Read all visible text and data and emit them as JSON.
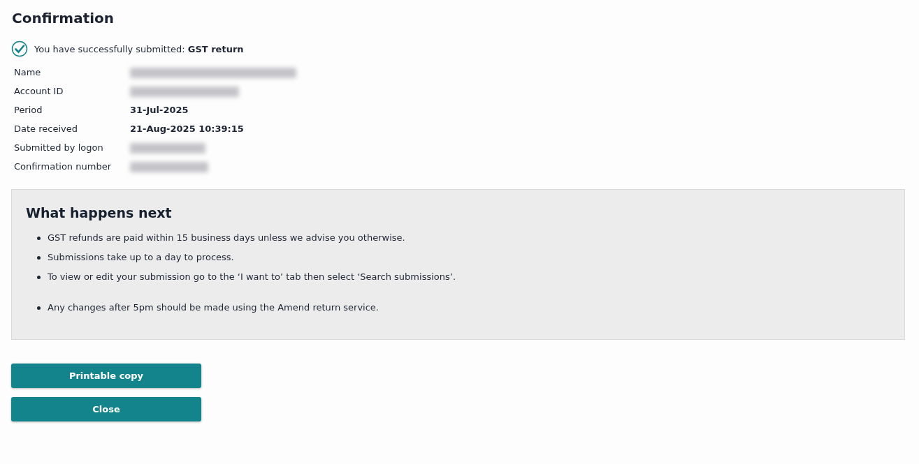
{
  "title": "Confirmation",
  "success": {
    "checked": true,
    "text": "You have successfully submitted: **GST return**"
  },
  "details": [
    {
      "label": "Name",
      "redacted": true
    },
    {
      "label": "Account ID",
      "redacted": true
    },
    {
      "label": "Period",
      "redacted": false,
      "value": "31-Jul-2025"
    },
    {
      "label": "Date received",
      "redacted": false,
      "value": "21-Aug-2025 10:39:15"
    },
    {
      "label": "Submitted by logon",
      "redacted": true
    },
    {
      "label": "Confirmation number",
      "redacted": true
    }
  ],
  "next": {
    "heading": "What happens next",
    "groups": [
      [
        "GST refunds are paid within 15 business days unless we advise you otherwise.",
        "Submissions take up to a day to process.",
        "To view or edit your submission go to the ‘I want to’ tab then select ‘Search submissions’."
      ],
      [
        "Any changes after 5pm should be made using the Amend return service."
      ]
    ]
  },
  "buttons": [
    "Printable copy",
    "Close"
  ]
}
